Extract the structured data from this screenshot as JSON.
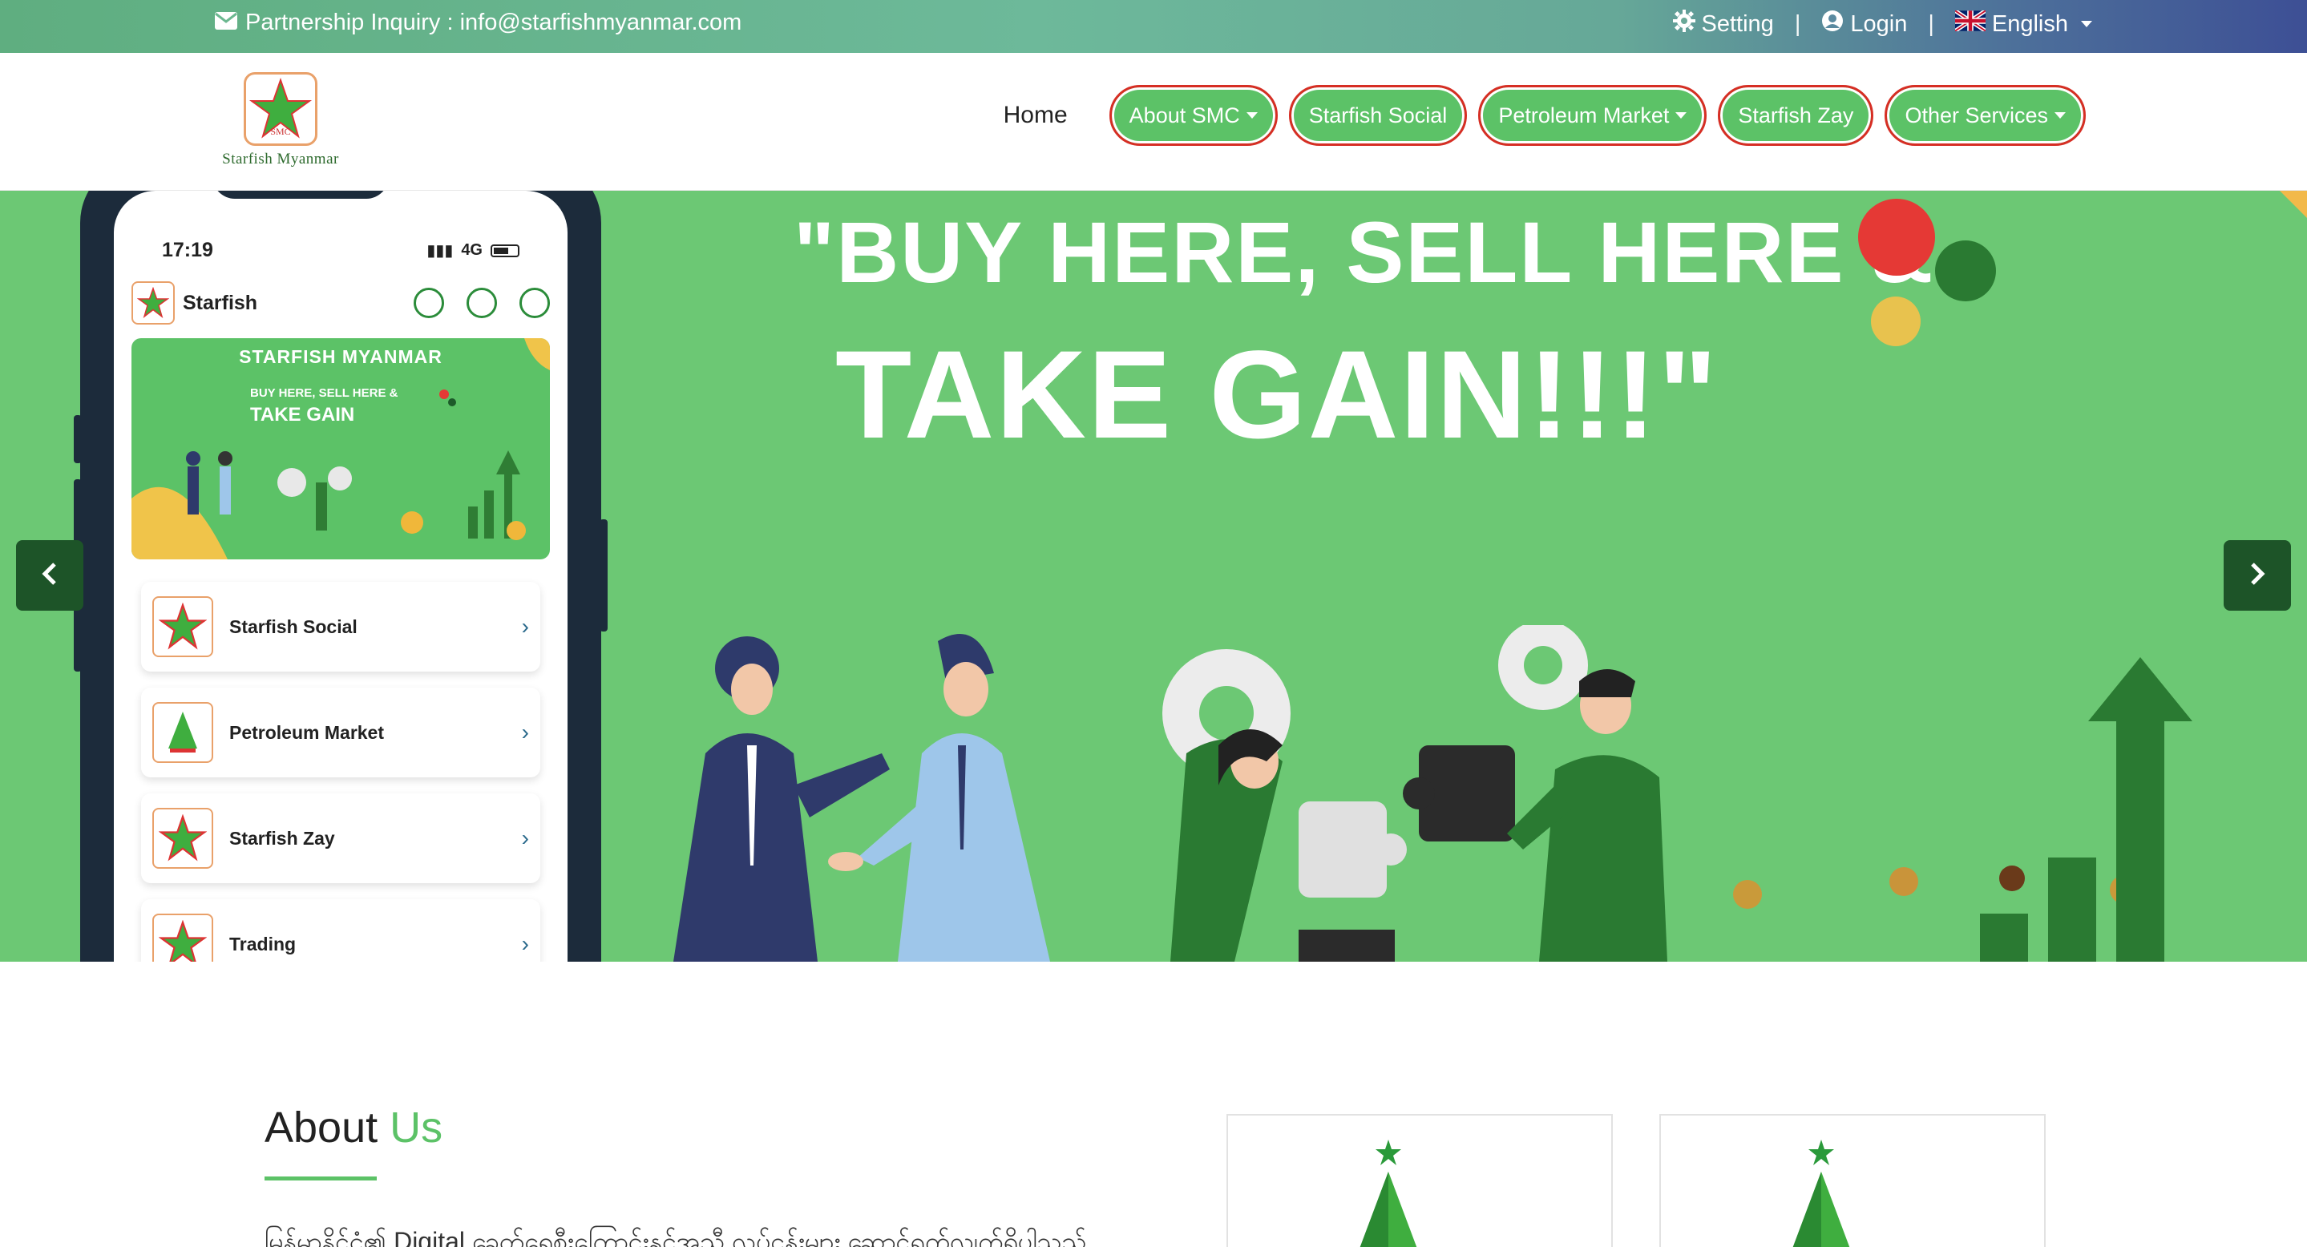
{
  "topbar": {
    "inquiry": "Partnership Inquiry : info@starfishmyanmar.com",
    "setting": "Setting",
    "separator": "|",
    "login": "Login",
    "language": "English"
  },
  "header": {
    "logo_text": "SMC",
    "logo_caption": "Starfish Myanmar",
    "nav": {
      "home": "Home",
      "about": "About SMC",
      "social": "Starfish Social",
      "petroleum": "Petroleum Market",
      "zay": "Starfish Zay",
      "other": "Other Services"
    }
  },
  "hero": {
    "headline_line1": "\"BUY HERE, SELL HERE &",
    "headline_line2": "TAKE GAIN!!!\"",
    "phone": {
      "time": "17:19",
      "network": "4G",
      "app_title": "Starfish",
      "banner_title": "STARFISH MYANMAR",
      "banner_sub1": "BUY HERE, SELL HERE &",
      "banner_sub2": "TAKE GAIN",
      "list": [
        {
          "label": "Starfish Social",
          "badge": "SMC"
        },
        {
          "label": "Petroleum Market",
          "badge": "APEX"
        },
        {
          "label": "Starfish Zay",
          "badge": "SMC"
        },
        {
          "label": "Trading",
          "badge": "SMC"
        }
      ]
    }
  },
  "about": {
    "title_part1": "About ",
    "title_part2": "Us",
    "text": "မြန်မာနိုင်ငံ၏ Digital ခေတ်ရေစီးကြောင်းနှင့်အညီ လုပ်ငန်းများ ဆောင်ရွက်လျက်ရှိပါသည်"
  },
  "colors": {
    "brand_green": "#5cc267",
    "hero_green": "#6cc874",
    "dark_green": "#1d5428",
    "pill_border": "#d62e24"
  },
  "icons": [
    "envelope-icon",
    "gear-icon",
    "user-circle-icon",
    "uk-flag-icon",
    "chevron-left-icon",
    "chevron-right-icon",
    "starfish-logo-icon"
  ]
}
